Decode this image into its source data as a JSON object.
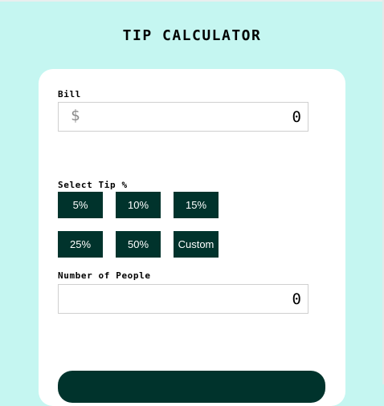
{
  "header": {
    "title": "TIP CALCULATOR"
  },
  "bill": {
    "label": "Bill",
    "currency_symbol": "$",
    "value": "0"
  },
  "tip": {
    "label": "Select Tip %",
    "options": [
      "5%",
      "10%",
      "15%",
      "25%",
      "50%",
      "Custom"
    ]
  },
  "people": {
    "label": "Number of People",
    "value": "0"
  },
  "colors": {
    "background": "#c5f6f1",
    "accent_dark": "#00332c",
    "card": "#ffffff"
  }
}
